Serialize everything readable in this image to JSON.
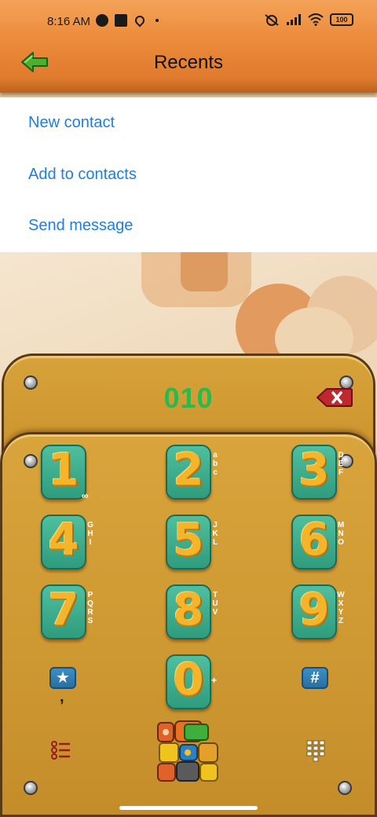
{
  "status_bar": {
    "time": "8:16 AM",
    "battery": "100"
  },
  "header": {
    "title": "Recents",
    "back_icon": "green-arrow-left-icon"
  },
  "menu": {
    "items": [
      {
        "label": "New contact"
      },
      {
        "label": "Add to contacts"
      },
      {
        "label": "Send message"
      }
    ]
  },
  "dialer": {
    "number": "010",
    "keys": [
      {
        "digit": "1",
        "letters": ""
      },
      {
        "digit": "2",
        "letters": "abc"
      },
      {
        "digit": "3",
        "letters": "DEF"
      },
      {
        "digit": "4",
        "letters": "GHI"
      },
      {
        "digit": "5",
        "letters": "JKL"
      },
      {
        "digit": "6",
        "letters": "MNO"
      },
      {
        "digit": "7",
        "letters": "PQRS"
      },
      {
        "digit": "8",
        "letters": "TUV"
      },
      {
        "digit": "9",
        "letters": "WXYZ"
      },
      {
        "digit": "0",
        "letters": "+"
      }
    ],
    "voicemail_symbol": "∞",
    "star_symbol": "★",
    "star_sub": ",",
    "hash_symbol": "#"
  },
  "colors": {
    "accent_blue": "#1e7fe0",
    "number_green": "#2eb84a",
    "header_orange": "#ec8c3c",
    "panel_gold": "#d09a33",
    "key_teal": "#2f9c7d",
    "digit_yellow": "#f5b52a"
  }
}
